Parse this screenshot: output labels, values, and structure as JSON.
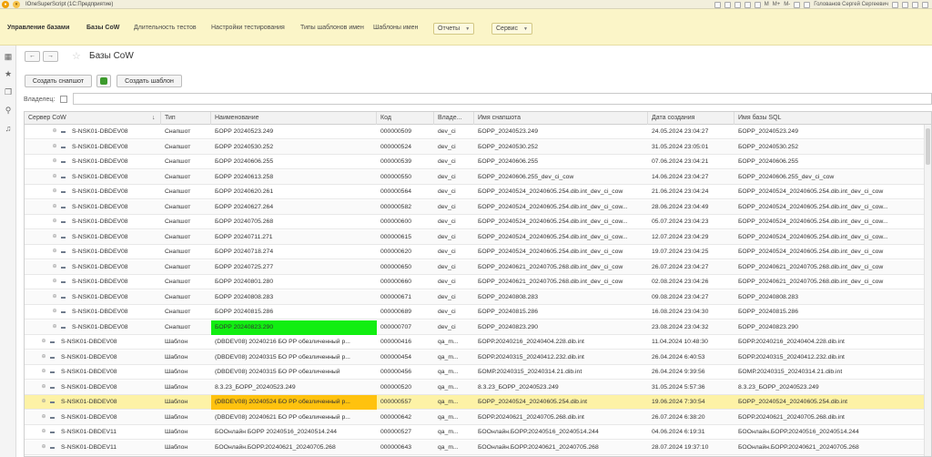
{
  "window": {
    "title": "IOneSuperScript (1С:Предприятие)",
    "user": "Голованов Сергей Сергеевич",
    "tools": [
      "M",
      "M+",
      "M-"
    ]
  },
  "sections": {
    "items": [
      "Управление базами",
      "Базы CoW",
      "Длительность тестов",
      "Настройки тестирования",
      "Типы шаблонов имен",
      "Шаблоны имен"
    ],
    "reports_label": "Отчеты",
    "service_label": "Сервис"
  },
  "form": {
    "title": "Базы CoW",
    "create_snapshot_label": "Создать снапшот",
    "create_template_label": "Создать шаблон",
    "owner_label": "Владелец:"
  },
  "table": {
    "columns": [
      "Сервер CoW",
      "Тип",
      "Наименование",
      "Код",
      "Владе...",
      "Имя снапшота",
      "Дата создания",
      "Имя базы SQL"
    ],
    "rows": [
      {
        "server": "S-NSK01-DBDEV08",
        "type": "Снапшот",
        "name": "БОРР 20240523.249",
        "code": "000000509",
        "owner": "dev_ci",
        "snapshot": "БОРР_20240523.249",
        "date": "24.05.2024 23:04:27",
        "sql": "БОРР_20240523.249",
        "child": true
      },
      {
        "server": "S-NSK01-DBDEV08",
        "type": "Снапшот",
        "name": "БОРР 20240530.252",
        "code": "000000524",
        "owner": "dev_ci",
        "snapshot": "БОРР_20240530.252",
        "date": "31.05.2024 23:05:01",
        "sql": "БОРР_20240530.252",
        "child": true
      },
      {
        "server": "S-NSK01-DBDEV08",
        "type": "Снапшот",
        "name": "БОРР 20240606.255",
        "code": "000000539",
        "owner": "dev_ci",
        "snapshot": "БОРР_20240606.255",
        "date": "07.06.2024 23:04:21",
        "sql": "БОРР_20240606.255",
        "child": true
      },
      {
        "server": "S-NSK01-DBDEV08",
        "type": "Снапшот",
        "name": "БОРР 20240613.258",
        "code": "000000550",
        "owner": "dev_ci",
        "snapshot": "БОРР_20240606.255_dev_ci_cow",
        "date": "14.06.2024 23:04:27",
        "sql": "БОРР_20240606.255_dev_ci_cow",
        "child": true
      },
      {
        "server": "S-NSK01-DBDEV08",
        "type": "Снапшот",
        "name": "БОРР 20240620.261",
        "code": "000000564",
        "owner": "dev_ci",
        "snapshot": "БОРР_20240524_20240605.254.dib.int_dev_ci_cow",
        "date": "21.06.2024 23:04:24",
        "sql": "БОРР_20240524_20240605.254.dib.int_dev_ci_cow",
        "child": true
      },
      {
        "server": "S-NSK01-DBDEV08",
        "type": "Снапшот",
        "name": "БОРР 20240627.264",
        "code": "000000582",
        "owner": "dev_ci",
        "snapshot": "БОРР_20240524_20240605.254.dib.int_dev_ci_cow...",
        "date": "28.06.2024 23:04:49",
        "sql": "БОРР_20240524_20240605.254.dib.int_dev_ci_cow...",
        "child": true
      },
      {
        "server": "S-NSK01-DBDEV08",
        "type": "Снапшот",
        "name": "БОРР 20240705.268",
        "code": "000000600",
        "owner": "dev_ci",
        "snapshot": "БОРР_20240524_20240605.254.dib.int_dev_ci_cow...",
        "date": "05.07.2024 23:04:23",
        "sql": "БОРР_20240524_20240605.254.dib.int_dev_ci_cow...",
        "child": true
      },
      {
        "server": "S-NSK01-DBDEV08",
        "type": "Снапшот",
        "name": "БОРР 20240711.271",
        "code": "000000615",
        "owner": "dev_ci",
        "snapshot": "БОРР_20240524_20240605.254.dib.int_dev_ci_cow...",
        "date": "12.07.2024 23:04:29",
        "sql": "БОРР_20240524_20240605.254.dib.int_dev_ci_cow...",
        "child": true
      },
      {
        "server": "S-NSK01-DBDEV08",
        "type": "Снапшот",
        "name": "БОРР 20240718.274",
        "code": "000000620",
        "owner": "dev_ci",
        "snapshot": "БОРР_20240524_20240605.254.dib.int_dev_ci_cow",
        "date": "19.07.2024 23:04:25",
        "sql": "БОРР_20240524_20240605.254.dib.int_dev_ci_cow",
        "child": true
      },
      {
        "server": "S-NSK01-DBDEV08",
        "type": "Снапшот",
        "name": "БОРР 20240725.277",
        "code": "000000650",
        "owner": "dev_ci",
        "snapshot": "БОРР_20240621_20240705.268.dib.int_dev_ci_cow",
        "date": "26.07.2024 23:04:27",
        "sql": "БОРР_20240621_20240705.268.dib.int_dev_ci_cow",
        "child": true
      },
      {
        "server": "S-NSK01-DBDEV08",
        "type": "Снапшот",
        "name": "БОРР 20240801.280",
        "code": "000000660",
        "owner": "dev_ci",
        "snapshot": "БОРР_20240621_20240705.268.dib.int_dev_ci_cow",
        "date": "02.08.2024 23:04:26",
        "sql": "БОРР_20240621_20240705.268.dib.int_dev_ci_cow",
        "child": true
      },
      {
        "server": "S-NSK01-DBDEV08",
        "type": "Снапшот",
        "name": "БОРР 20240808.283",
        "code": "000000671",
        "owner": "dev_ci",
        "snapshot": "БОРР_20240808.283",
        "date": "09.08.2024 23:04:27",
        "sql": "БОРР_20240808.283",
        "child": true
      },
      {
        "server": "S-NSK01-DBDEV08",
        "type": "Снапшот",
        "name": "БОРР 20240815.286",
        "code": "000000689",
        "owner": "dev_ci",
        "snapshot": "БОРР_20240815.286",
        "date": "16.08.2024 23:04:30",
        "sql": "БОРР_20240815.286",
        "child": true
      },
      {
        "server": "S-NSK01-DBDEV08",
        "type": "Снапшот",
        "name": "БОРР 20240823.290",
        "code": "000000707",
        "owner": "dev_ci",
        "snapshot": "БОРР_20240823.290",
        "date": "23.08.2024 23:04:32",
        "sql": "БОРР_20240823.290",
        "child": true,
        "highlight": "green"
      },
      {
        "server": "S-NSK01-DBDEV08",
        "type": "Шаблон",
        "name": "(DBDEV08) 20240216 БО РР обезличенный р...",
        "code": "000000416",
        "owner": "qa_m...",
        "snapshot": "БОРР.20240216_20240404.228.dib.int",
        "date": "11.04.2024 10:48:30",
        "sql": "БОРР.20240216_20240404.228.dib.int"
      },
      {
        "server": "S-NSK01-DBDEV08",
        "type": "Шаблон",
        "name": "(DBDEV08) 20240315 БО РР обезличенный р...",
        "code": "000000454",
        "owner": "qa_m...",
        "snapshot": "БОРР.20240315_20240412.232.dib.int",
        "date": "26.04.2024 6:40:53",
        "sql": "БОРР.20240315_20240412.232.dib.int"
      },
      {
        "server": "S-NSK01-DBDEV08",
        "type": "Шаблон",
        "name": "(DBDEV08) 20240315 БО РР обезличенный",
        "code": "000000456",
        "owner": "qa_m...",
        "snapshot": "БОМР.20240315_20240314.21.dib.int",
        "date": "26.04.2024 9:39:56",
        "sql": "БОМР.20240315_20240314.21.dib.int"
      },
      {
        "server": "S-NSK01-DBDEV08",
        "type": "Шаблон",
        "name": "8.3.23_БОРР_20240523.249",
        "code": "000000520",
        "owner": "qa_m...",
        "snapshot": "8.3.23_БОРР_20240523.249",
        "date": "31.05.2024 5:57:36",
        "sql": "8.3.23_БОРР_20240523.249"
      },
      {
        "server": "S-NSK01-DBDEV08",
        "type": "Шаблон",
        "name": "(DBDEV08) 20240524 БО РР обезличенный р...",
        "code": "000000557",
        "owner": "qa_m...",
        "snapshot": "БОРР_20240524_20240605.254.dib.int",
        "date": "19.06.2024 7:30:54",
        "sql": "БОРР_20240524_20240605.254.dib.int",
        "highlight": "yellow",
        "selected": true
      },
      {
        "server": "S-NSK01-DBDEV08",
        "type": "Шаблон",
        "name": "(DBDEV08) 20240621 БО РР обезличенный р...",
        "code": "000000642",
        "owner": "qa_m...",
        "snapshot": "БОРР.20240621_20240705.268.dib.int",
        "date": "26.07.2024 6:38:20",
        "sql": "БОРР.20240621_20240705.268.dib.int"
      },
      {
        "server": "S-NSK01-DBDEV11",
        "type": "Шаблон",
        "name": "БООнлайн БОРР 20240516_20240514.244",
        "code": "000000527",
        "owner": "qa_m...",
        "snapshot": "БООнлайн.БОРР.20240516_20240514.244",
        "date": "04.06.2024 6:19:31",
        "sql": "БООнлайн.БОРР.20240516_20240514.244"
      },
      {
        "server": "S-NSK01-DBDEV11",
        "type": "Шаблон",
        "name": "БООнлайн.БОРР.20240621_20240705.268",
        "code": "000000643",
        "owner": "qa_m...",
        "snapshot": "БООнлайн.БОРР.20240621_20240705.268",
        "date": "28.07.2024 19:37:10",
        "sql": "БООнлайн.БОРР.20240621_20240705.268"
      }
    ]
  },
  "colors": {
    "section_bar": "#fbf5c8",
    "highlight_green": "#11ee11",
    "highlight_yellow": "#ffc20e",
    "selected_row": "#fdf2a6"
  },
  "icons": {
    "sidebar": [
      "apps-grid-icon",
      "favorites-star-icon",
      "history-icon",
      "search-icon",
      "notifications-bell-icon"
    ],
    "toolbar": [
      "back-arrow-icon",
      "forward-arrow-icon",
      "favorite-star-icon",
      "refresh-green-icon"
    ]
  }
}
